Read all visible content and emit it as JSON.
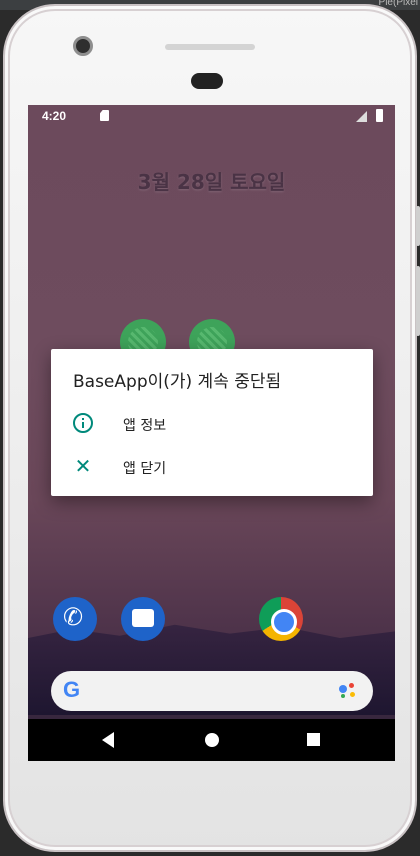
{
  "ide": {
    "label": "Pie(Pixel"
  },
  "statusbar": {
    "time": "4:20",
    "sd_icon": "sd-card-icon",
    "signal_icon": "signal-icon",
    "battery_icon": "battery-icon"
  },
  "home": {
    "date": "3월 28일 토요일",
    "dock": [
      "phone-app-icon",
      "messages-app-icon",
      "chrome-app-icon"
    ],
    "search_logo": "G"
  },
  "dialog": {
    "title": "BaseApp이(가) 계속 중단됨",
    "items": [
      {
        "label": "앱 정보",
        "icon": "info-icon"
      },
      {
        "label": "앱 닫기",
        "icon": "close-icon"
      }
    ],
    "accent": "#00897b"
  },
  "navbar": {
    "icons": [
      "back-icon",
      "home-icon",
      "recents-icon"
    ]
  }
}
